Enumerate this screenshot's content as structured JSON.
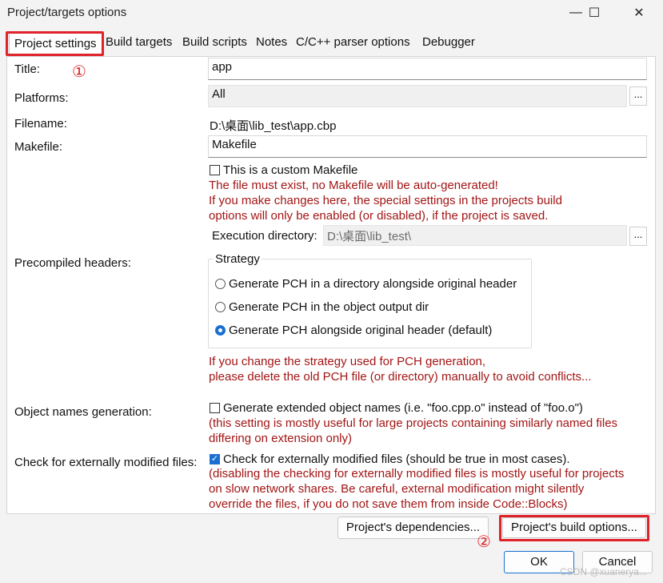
{
  "window": {
    "title": "Project/targets options",
    "minimize": "—",
    "maximize": "☐",
    "close": "✕"
  },
  "tabs": [
    {
      "label": "Project settings",
      "active": true
    },
    {
      "label": "Build targets"
    },
    {
      "label": "Build scripts"
    },
    {
      "label": "Notes"
    },
    {
      "label": "C/C++ parser options"
    },
    {
      "label": "Debugger"
    }
  ],
  "annotations": {
    "marker1": "①",
    "marker2": "②",
    "highlight_color": "#e0222a"
  },
  "form": {
    "title_label": "Title:",
    "title_value": "app",
    "platforms_label": "Platforms:",
    "platforms_value": "All",
    "platforms_button": "...",
    "filename_label": "Filename:",
    "filename_value": "D:\\桌面\\lib_test\\app.cbp",
    "makefile_label": "Makefile:",
    "makefile_value": "Makefile",
    "custom_makefile_label": "This is a custom Makefile",
    "custom_makefile_checked": false,
    "makefile_warnings": [
      "The file must exist, no Makefile will be auto-generated!",
      "If you make changes here, the special settings in the projects build",
      "options will only be enabled (or disabled), if the project is saved."
    ],
    "exec_dir_label": "Execution directory:",
    "exec_dir_value": "D:\\桌面\\lib_test\\",
    "exec_dir_button": "...",
    "pch_label": "Precompiled headers:",
    "strategy_legend": "Strategy",
    "strategy_options": [
      {
        "label": "Generate PCH in a directory alongside original header",
        "selected": false
      },
      {
        "label": "Generate PCH in the object output dir",
        "selected": false
      },
      {
        "label": "Generate PCH alongside original header (default)",
        "selected": true
      }
    ],
    "pch_warnings": [
      "If you change the strategy used for PCH generation,",
      "please delete the old PCH file (or directory) manually to avoid conflicts..."
    ],
    "objnames_label": "Object names generation:",
    "objnames_check_label": "Generate extended object names (i.e. \"foo.cpp.o\" instead of \"foo.o\")",
    "objnames_checked": false,
    "objnames_notes": [
      "(this setting is mostly useful for large projects containing similarly named files",
      "differing on extension only)"
    ],
    "extmod_label": "Check for externally modified files:",
    "extmod_check_label": "Check for externally modified files (should be true in most cases).",
    "extmod_checked": true,
    "extmod_notes": [
      "(disabling the checking for externally modified files is mostly useful for projects",
      "on slow network shares. Be careful, external modification might silently",
      "override the files, if you do not save them from inside Code::Blocks)"
    ]
  },
  "buttons": {
    "dependencies": "Project's dependencies...",
    "build_options": "Project's build options...",
    "ok": "OK",
    "cancel": "Cancel"
  },
  "watermark": "CSDN @xuanerya..."
}
